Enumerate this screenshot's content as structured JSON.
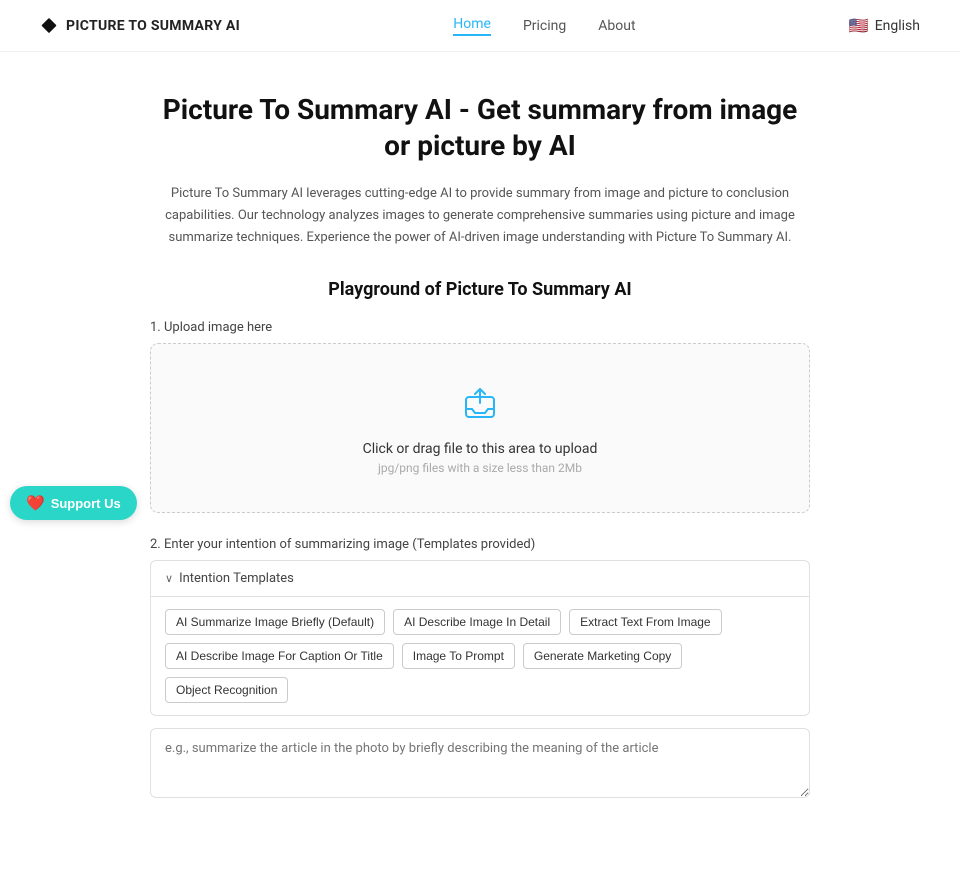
{
  "navbar": {
    "logo_text": "PICTURE TO SUMMARY AI",
    "links": [
      {
        "label": "Home",
        "active": true
      },
      {
        "label": "Pricing",
        "active": false
      },
      {
        "label": "About",
        "active": false
      }
    ],
    "language": "English",
    "flag": "🇺🇸"
  },
  "hero": {
    "title": "Picture To Summary AI - Get summary from image or picture by AI",
    "description": "Picture To Summary AI leverages cutting-edge AI to provide summary from image and picture to conclusion capabilities. Our technology analyzes images to generate comprehensive summaries using picture and image summarize techniques. Experience the power of AI-driven image understanding with Picture To Summary AI."
  },
  "playground": {
    "section_title": "Playground of Picture To Summary AI",
    "upload_label": "1. Upload image here",
    "upload_main_text": "Click or drag file to this area to upload",
    "upload_sub_text": "jpg/png files with a size less than 2Mb",
    "intention_label": "2. Enter your intention of summarizing image (Templates provided)",
    "intention_templates_label": "Intention Templates",
    "tags": [
      "AI Summarize Image Briefly (Default)",
      "AI Describe Image In Detail",
      "Extract Text From Image",
      "AI Describe Image For Caption Or Title",
      "Image To Prompt",
      "Generate Marketing Copy",
      "Object Recognition"
    ],
    "textarea_placeholder": "e.g., summarize the article in the photo by briefly describing the meaning of the article"
  },
  "support": {
    "label": "Support Us",
    "icon": "❤️"
  }
}
